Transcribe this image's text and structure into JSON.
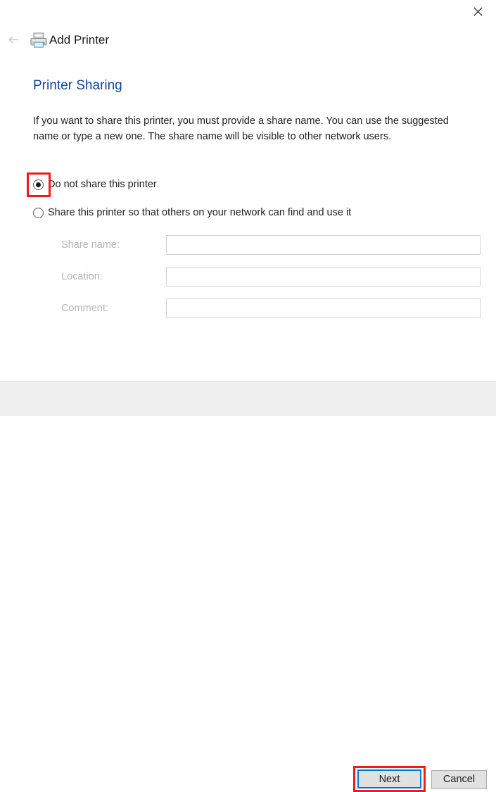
{
  "window": {
    "title": "Add Printer",
    "close_label": "✕",
    "back_label": "←",
    "printer_icon": "printer-icon",
    "close_icon": "close-icon",
    "back_icon": "back-arrow-icon"
  },
  "page": {
    "heading": "Printer Sharing",
    "heading_color": "#10459e",
    "intro": "If you want to share this printer, you must provide a share name. You can use the suggested name or type a new one. The share name will be visible to other network users."
  },
  "options": [
    {
      "id": "do-not-share",
      "label": "Do not share this printer",
      "checked": true,
      "highlighted": true
    },
    {
      "id": "share-printer",
      "label": "Share this printer so that others on your network can find and use it",
      "checked": false,
      "highlighted": false
    }
  ],
  "fields": [
    {
      "id": "share-name",
      "label": "Share name:",
      "value": "",
      "placeholder": "",
      "disabled": true
    },
    {
      "id": "location",
      "label": "Location:",
      "value": "",
      "placeholder": "",
      "disabled": true
    },
    {
      "id": "comment",
      "label": "Comment:",
      "value": "",
      "placeholder": "",
      "disabled": true
    }
  ],
  "footer": {
    "next_label": "Next",
    "cancel_label": "Cancel",
    "next_highlighted": true,
    "focus_color": "#0078d7"
  },
  "annotation": {
    "color": "#ef1c1c",
    "targets": [
      "do-not-share-radio",
      "next-button"
    ]
  }
}
